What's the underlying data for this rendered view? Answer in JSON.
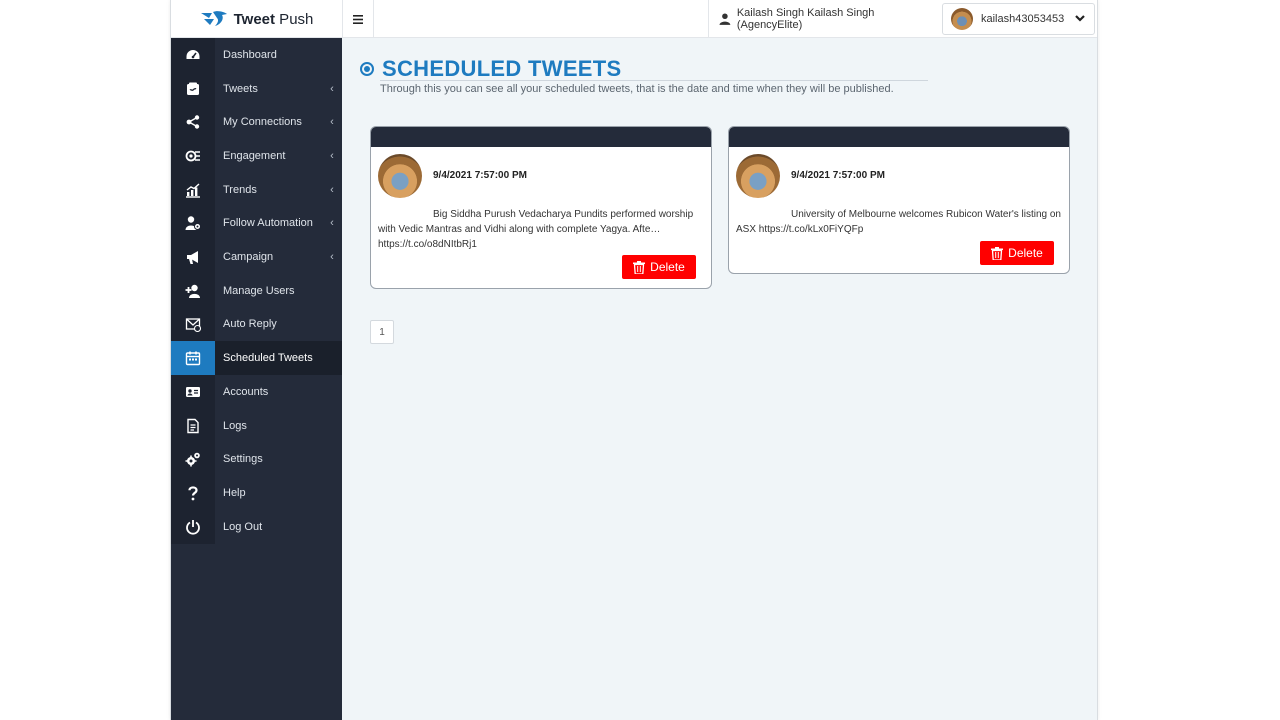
{
  "brand": {
    "name_bold": "Tweet",
    "name_rest": " Push"
  },
  "topbar": {
    "menu_icon": "hamburger-icon",
    "user_display": "Kailash Singh Kailash Singh (AgencyElite)",
    "account_handle": "kailash43053453"
  },
  "sidebar": {
    "items": [
      {
        "label": "Dashboard",
        "icon": "dashboard-icon",
        "caret": ""
      },
      {
        "label": "Tweets",
        "icon": "tweets-icon",
        "caret": "‹"
      },
      {
        "label": "My Connections",
        "icon": "connections-icon",
        "caret": "‹"
      },
      {
        "label": "Engagement",
        "icon": "engagement-icon",
        "caret": "‹"
      },
      {
        "label": "Trends",
        "icon": "trends-icon",
        "caret": "‹"
      },
      {
        "label": "Follow Automation",
        "icon": "follow-automation-icon",
        "caret": "‹"
      },
      {
        "label": "Campaign",
        "icon": "campaign-icon",
        "caret": "‹"
      },
      {
        "label": "Manage Users",
        "icon": "add-user-icon",
        "caret": ""
      },
      {
        "label": "Auto Reply",
        "icon": "auto-reply-icon",
        "caret": ""
      },
      {
        "label": "Scheduled Tweets",
        "icon": "calendar-icon",
        "caret": "",
        "active": true
      },
      {
        "label": "Accounts",
        "icon": "id-card-icon",
        "caret": ""
      },
      {
        "label": "Logs",
        "icon": "document-icon",
        "caret": ""
      },
      {
        "label": "Settings",
        "icon": "gears-icon",
        "caret": ""
      },
      {
        "label": "Help",
        "icon": "question-icon",
        "caret": ""
      },
      {
        "label": "Log Out",
        "icon": "power-icon",
        "caret": ""
      }
    ]
  },
  "main": {
    "title": "SCHEDULED TWEETS",
    "subtitle": "Through this you can see all your scheduled tweets, that is the date and time when they will be published.",
    "cards": [
      {
        "date": "9/4/2021 7:57:00 PM",
        "text": "Big Siddha Purush Vedacharya Pundits performed worship with Vedic Mantras and Vidhi along with complete Yagya. Afte… https://t.co/o8dNItbRj1",
        "delete_label": "Delete"
      },
      {
        "date": "9/4/2021 7:57:00 PM",
        "text": "University of Melbourne welcomes Rubicon Water's listing on ASX https://t.co/kLx0FiYQFp",
        "delete_label": "Delete"
      }
    ],
    "pagination": {
      "current": "1"
    }
  },
  "colors": {
    "accent": "#1e7bc0",
    "sidebar_bg": "#242b3a",
    "danger": "#ff0000"
  }
}
